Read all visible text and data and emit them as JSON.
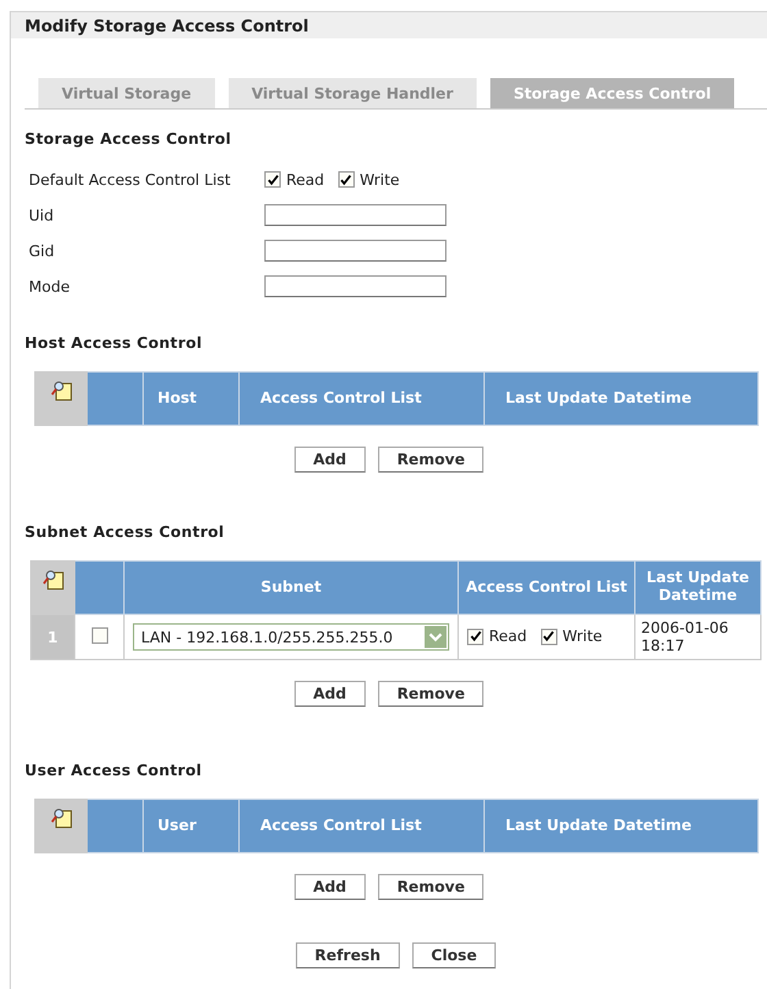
{
  "window": {
    "title": "Modify Storage Access Control"
  },
  "tabs": [
    {
      "label": "Virtual Storage",
      "selected": false
    },
    {
      "label": "Virtual Storage Handler",
      "selected": false
    },
    {
      "label": "Storage Access Control",
      "selected": true
    }
  ],
  "storage": {
    "heading": "Storage Access Control",
    "acl_label": "Default Access Control List",
    "acl": [
      {
        "label": "Read",
        "checked": true
      },
      {
        "label": "Write",
        "checked": true
      }
    ],
    "fields": [
      {
        "label": "Uid"
      },
      {
        "label": "Gid"
      },
      {
        "label": "Mode"
      }
    ]
  },
  "host": {
    "heading": "Host Access Control",
    "columns": [
      "Host",
      "Access Control List",
      "Last Update Datetime"
    ],
    "buttons": [
      "Add",
      "Remove"
    ]
  },
  "subnet": {
    "heading": "Subnet Access Control",
    "columns": [
      "Subnet",
      "Access Control List",
      "Last Update Datetime"
    ],
    "rows": [
      {
        "index": "1",
        "checked": false,
        "subnet": "LAN - 192.168.1.0/255.255.255.0",
        "acl": [
          {
            "label": "Read",
            "checked": true
          },
          {
            "label": "Write",
            "checked": true
          }
        ],
        "datetime": "2006-01-06 18:17"
      }
    ],
    "buttons": [
      "Add",
      "Remove"
    ]
  },
  "user": {
    "heading": "User Access Control",
    "columns": [
      "User",
      "Access Control List",
      "Last Update Datetime"
    ],
    "buttons": [
      "Add",
      "Remove"
    ]
  },
  "footer_buttons": [
    "Refresh",
    "Close"
  ]
}
